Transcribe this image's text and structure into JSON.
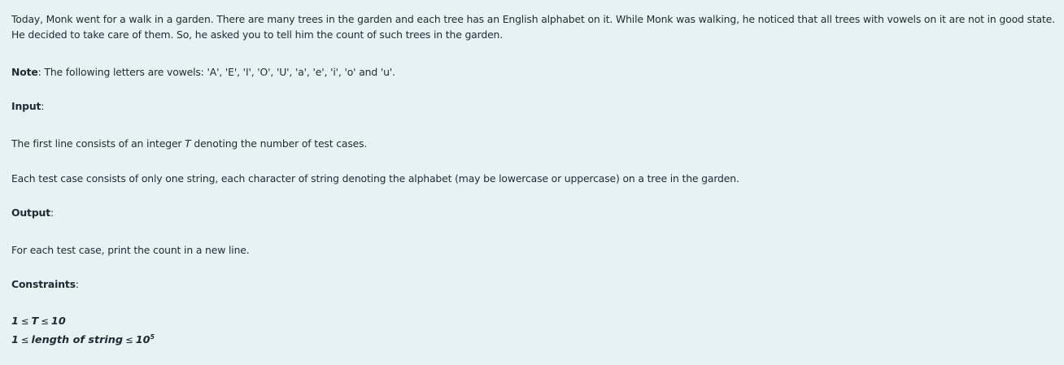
{
  "problem": {
    "statement": "Today, Monk went for a walk in a garden. There are many trees in the garden and each tree has an English alphabet on it. While Monk was walking, he noticed that all trees with vowels on it are not in good state. He decided to take care of them. So, he asked you to tell him the count of such trees in the garden.",
    "note": {
      "label": "Note",
      "text": ": The following letters are vowels: 'A', 'E', 'I', 'O', 'U', 'a', 'e', 'i', 'o' and 'u'."
    },
    "input": {
      "heading": "Input",
      "line1_before": "The first line consists of an integer ",
      "line1_var": "T",
      "line1_after": " denoting the number of test cases.",
      "line2": "Each test case consists of only one string, each character of string denoting the alphabet (may be lowercase or uppercase) on a tree in the garden."
    },
    "output": {
      "heading": "Output",
      "text": "For each test case, print the count in a new line."
    },
    "constraints": {
      "heading": "Constraints",
      "c1_left": "1",
      "c1_op1": "≤",
      "c1_var": "T",
      "c1_op2": "≤",
      "c1_right": "10",
      "c2_left": "1",
      "c2_op1": "≤",
      "c2_var": "length of string",
      "c2_op2": "≤",
      "c2_base": "10",
      "c2_exp": "5"
    }
  }
}
